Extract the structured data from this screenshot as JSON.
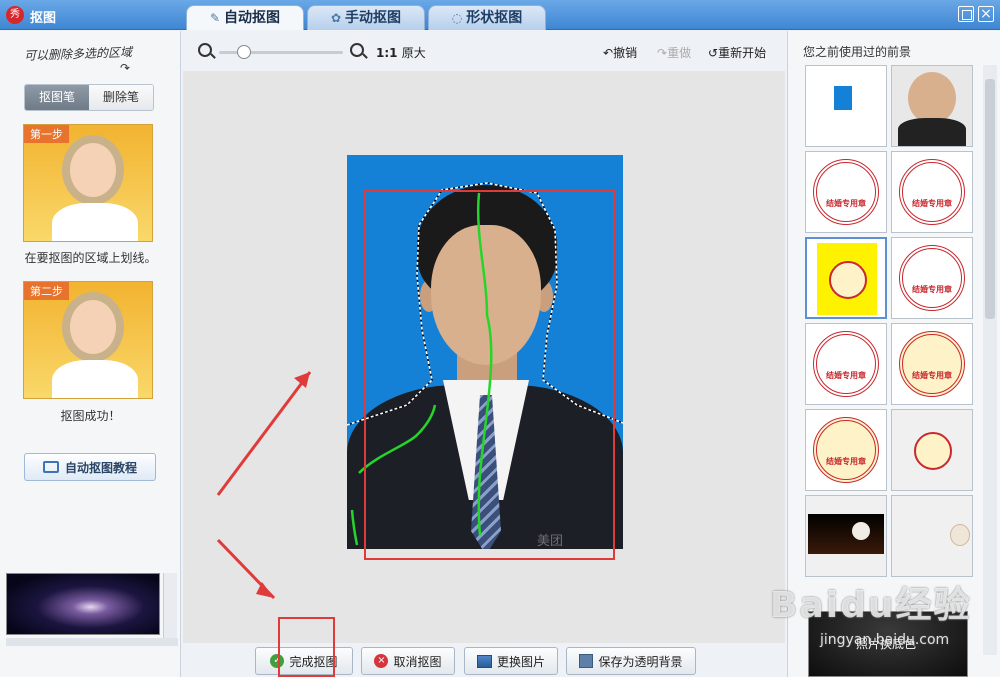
{
  "window": {
    "title": "抠图",
    "app_icon": "秀"
  },
  "tabs": [
    {
      "label": "自动抠图",
      "icon": "brush-icon",
      "active": true
    },
    {
      "label": "手动抠图",
      "icon": "gear-icon",
      "active": false
    },
    {
      "label": "形状抠图",
      "icon": "shape-icon",
      "active": false
    }
  ],
  "left": {
    "hint": "可以删除多选的区域",
    "pen_active": "抠图笔",
    "pen_erase": "删除笔",
    "step1_tag": "第一步",
    "step1_text": "在要抠图的区域上划线。",
    "step2_tag": "第二步",
    "step2_text": "抠图成功！",
    "tutorial": "自动抠图教程"
  },
  "toolbar": {
    "ratio": "1:1",
    "ratio_label": "原大",
    "undo": "撤销",
    "redo": "重做",
    "restart": "重新开始",
    "zoom_level": 0.2
  },
  "canvas": {
    "watermark": "美团"
  },
  "buttons": {
    "finish": "完成抠图",
    "cancel": "取消抠图",
    "change": "更换图片",
    "save": "保存为透明背景"
  },
  "right": {
    "title": "您之前使用过的前景",
    "stamp_text": "结婚专用章",
    "bottom_text": "照片换底色"
  },
  "watermark": {
    "brand": "Baidu经验",
    "url": "jingyan.baidu.com"
  },
  "colors": {
    "accent": "#3f86d3",
    "highlight": "#e03b3b",
    "stroke": "#25d62a"
  }
}
